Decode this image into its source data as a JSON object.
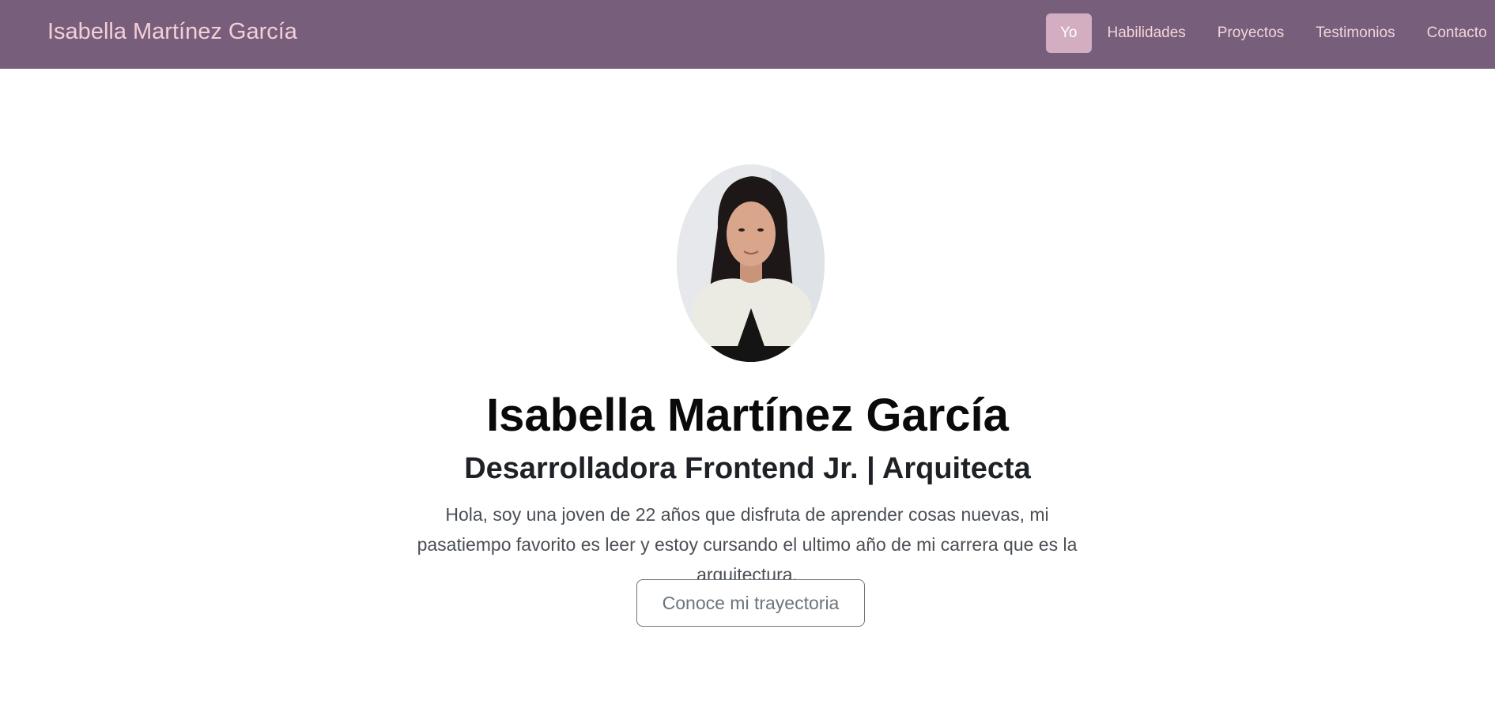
{
  "navbar": {
    "brand": "Isabella Martínez García",
    "links": [
      {
        "label": "Yo",
        "active": true
      },
      {
        "label": "Habilidades",
        "active": false
      },
      {
        "label": "Proyectos",
        "active": false
      },
      {
        "label": "Testimonios",
        "active": false
      },
      {
        "label": "Contacto",
        "active": false
      }
    ]
  },
  "hero": {
    "name": "Isabella Martínez García",
    "role": "Desarrolladora Frontend Jr. | Arquitecta",
    "bio": "Hola, soy una joven de 22 años que disfruta de aprender cosas nuevas, mi pasatiempo favorito es leer y estoy cursando el ultimo año de mi carrera que es la arquitectura.",
    "cta_label": "Conoce mi trayectoria"
  },
  "colors": {
    "navbar_bg": "#775e7a",
    "brand_text": "#f3cfd8",
    "nav_active_bg": "#d3adc1"
  }
}
